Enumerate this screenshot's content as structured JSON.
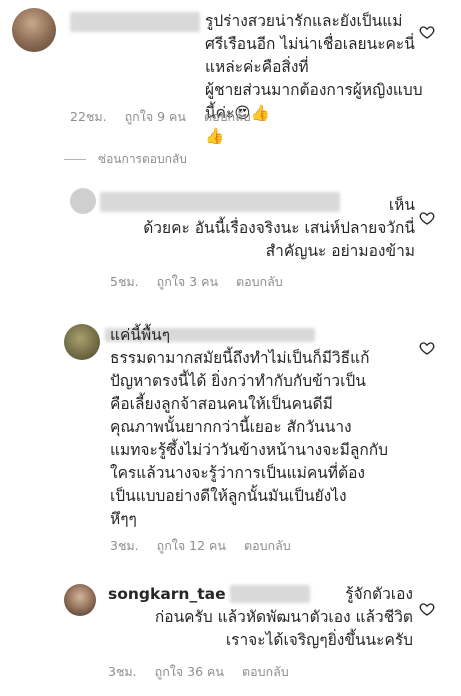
{
  "comments": [
    {
      "username": "",
      "text": "รูปร่างสวยน่ารักและยังเป็นแม่\nศรีเรือนอีก ไม่น่าเชื่อเลยนะคะนี่แหล่ะค่ะคือสิ่งที่\nผู้ชายส่วนมากต้องการผู้หญิงแบบนี้ค่ะ😍👍\n👍",
      "time": "22ชม.",
      "likes": "ถูกใจ 9 คน",
      "reply": "ตอบกลับ"
    },
    {
      "username": "",
      "text": "เห็น\nด้วยคะ  อันนี้เรื่องจริงนะ เสน่ห์ปลายจวักนี่\nสำคัญนะ อย่ามองข้าม",
      "time": "5ชม.",
      "likes": "ถูกใจ 3 คน",
      "reply": "ตอบกลับ"
    },
    {
      "username": "",
      "text": "แค่นี้พื้นๆ\nธรรมดามากสมัยนี้ถึงทำไม่เป็นก็มีวิธีแก้\nปัญหาตรงนี้ได้  ยิ่งกว่าทำกับกับข้าวเป็น\nคือเลี้ยงลูกจ้าสอนคนให้เป็นคนดีมี\nคุณภาพนั้นยากกว่านี้เยอะ  สักวันนาง\nแมทจะรู้ซึ้งไม่ว่าวันข้างหน้านางจะมีลูกกับ\nใครแล้วนางจะรู้ว่าการเป็นแม่คนที่ต้อง\nเป็นแบบอย่างดีให้ลูกนั้นมันเป็นยังไง\nหึๆๆ",
      "time": "3ชม.",
      "likes": "ถูกใจ 12 คน",
      "reply": "ตอบกลับ"
    },
    {
      "username": "songkarn_tae",
      "text": "รู้จักตัวเอง\nก่อนครับ แล้วหัดพัฒนาตัวเอง แล้วชีวิต\nเราจะได้เจริญๆยิ่งขึ้นนะครับ",
      "time": "3ชม.",
      "likes": "ถูกใจ 36 คน",
      "reply": "ตอบกลับ"
    }
  ],
  "hide_replies": "ซ่อนการตอบกลับ"
}
